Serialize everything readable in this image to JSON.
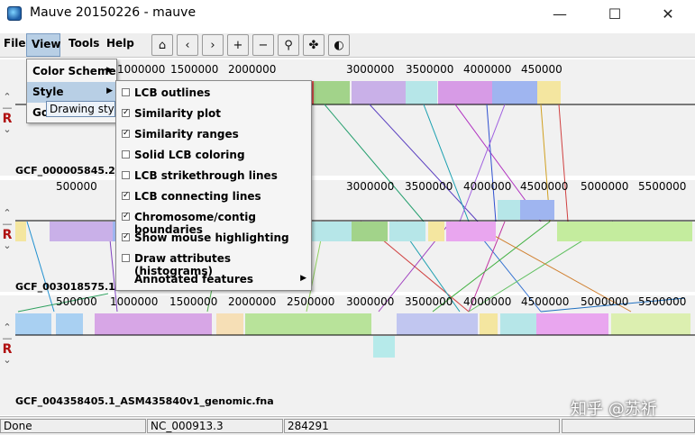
{
  "window": {
    "title": "Mauve 20150226 - mauve",
    "minimize": "—",
    "maximize": "☐",
    "close": "✕"
  },
  "menubar": {
    "file": "File",
    "view": "View",
    "tools": "Tools",
    "help": "Help"
  },
  "toolbar": {
    "home": "⌂",
    "back": "‹",
    "forward": "›",
    "zoom_in": "+",
    "zoom_out": "−",
    "zoom": "⚲",
    "bird": "✤",
    "color": "◐"
  },
  "view_menu": {
    "items": [
      {
        "label": "Color Scheme"
      },
      {
        "label": "Style"
      },
      {
        "label": "Go"
      }
    ]
  },
  "tooltip": "Drawing style",
  "style_menu": {
    "items": [
      {
        "label": "LCB outlines",
        "checked": false
      },
      {
        "label": "Similarity plot",
        "checked": true
      },
      {
        "label": "Similarity ranges",
        "checked": true
      },
      {
        "label": "Solid LCB coloring",
        "checked": false
      },
      {
        "label": "LCB strikethrough lines",
        "checked": false
      },
      {
        "label": "LCB connecting lines",
        "checked": true
      },
      {
        "label": "Chromosome/contig boundaries",
        "checked": true
      },
      {
        "label": "Show mouse highlighting",
        "checked": true
      },
      {
        "label": "Draw attributes (histograms)",
        "checked": false
      },
      {
        "label": "Annotated features",
        "checked": false
      }
    ]
  },
  "genomes": [
    {
      "label": "GCF_000005845.2_",
      "ticks": [
        "1000000",
        "1500000",
        "2000000",
        "3000000",
        "3500000",
        "4000000",
        "450000"
      ]
    },
    {
      "label": "GCF_003018575.1",
      "ticks": [
        "500000",
        "3000000",
        "3500000",
        "4000000",
        "4500000",
        "5000000",
        "5500000"
      ]
    },
    {
      "label": "GCF_004358405.1_ASM435840v1_genomic.fna",
      "ticks": [
        "500000",
        "1000000",
        "1500000",
        "2000000",
        "2500000",
        "3000000",
        "3500000",
        "4000000",
        "4500000",
        "5000000",
        "5500000"
      ]
    }
  ],
  "controls": {
    "up": "⌃",
    "reverse": "R",
    "down": "⌄",
    "minus": "—"
  },
  "status": {
    "state": "Done",
    "sequence": "NC_000913.3",
    "position": "284291"
  },
  "watermark": "知乎 @苏祈"
}
